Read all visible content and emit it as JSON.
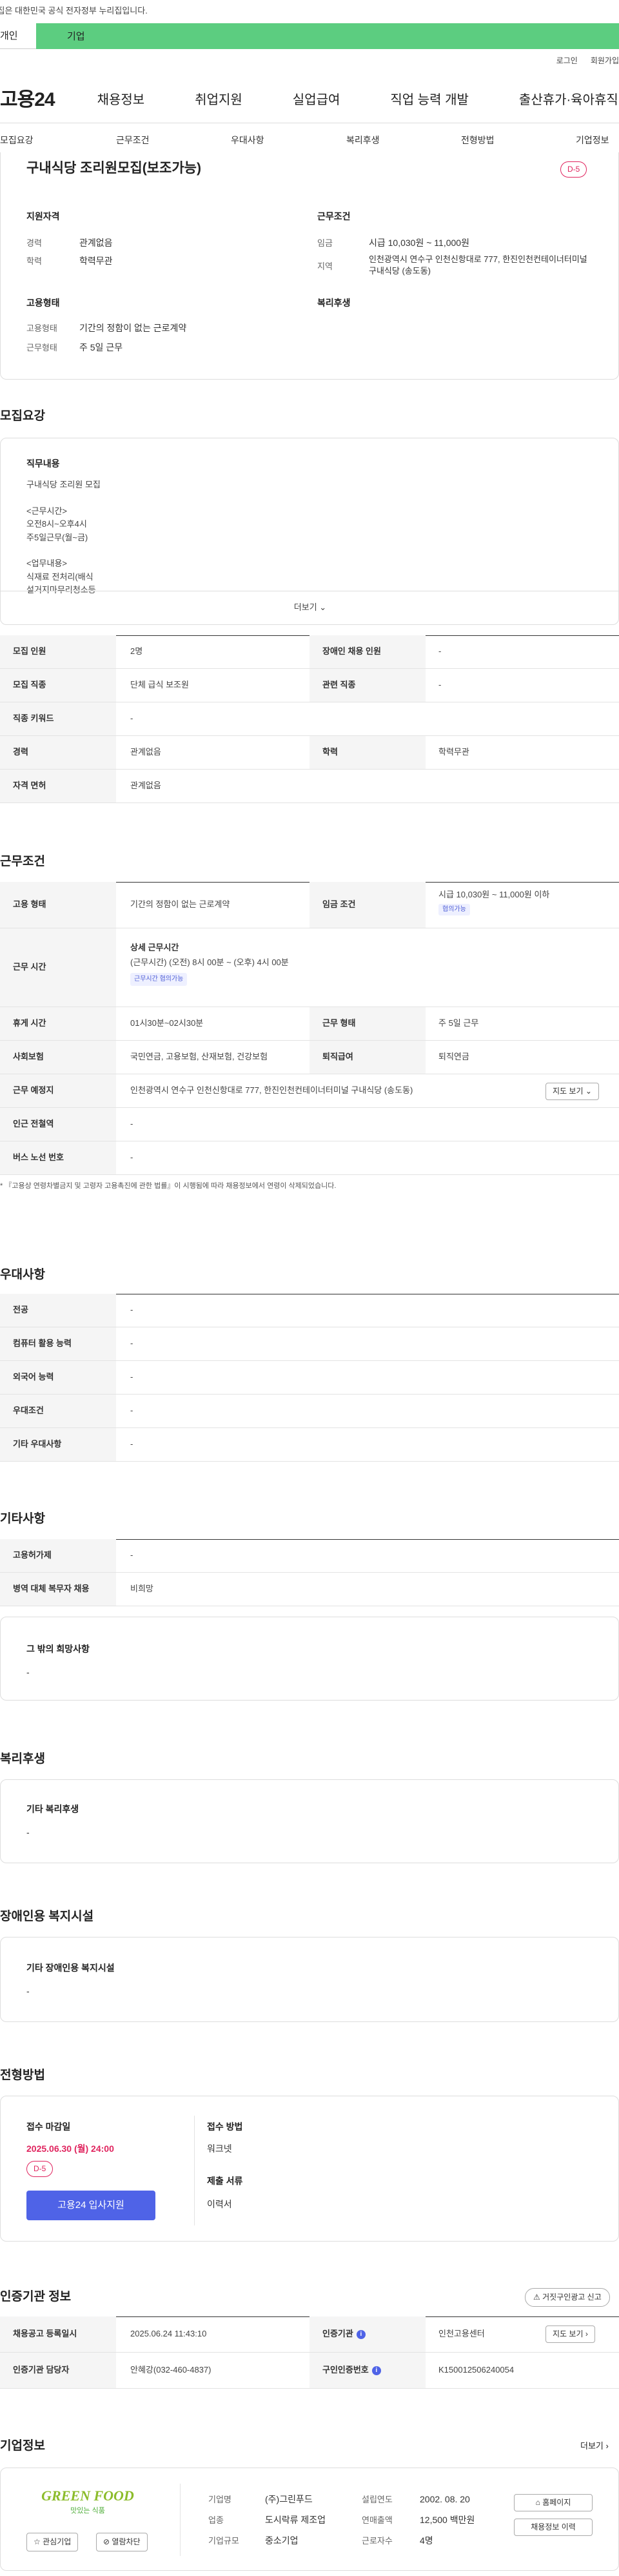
{
  "notice": "이 누리집은 대한민국 공식 전자정부 누리집입니다.",
  "user_tabs": [
    "개인",
    "기업"
  ],
  "util": [
    "로그인",
    "회원가입"
  ],
  "gnb": {
    "logo": "고용24",
    "menu": [
      "채용정보",
      "취업지원",
      "실업급여",
      "직업 능력 개발",
      "출산휴가·육아휴직"
    ]
  },
  "snb": [
    "모집요강",
    "근무조건",
    "우대사항",
    "복리후생",
    "전형방법",
    "기업정보"
  ],
  "summary": {
    "title": "구내식당 조리원모집(보조가능)",
    "dday": "D-5",
    "qual_title": "지원자격",
    "career_k": "경력",
    "career_v": "관계없음",
    "edu_k": "학력",
    "edu_v": "학력무관",
    "work_title": "근무조건",
    "wage_k": "임금",
    "wage_v": "시급 10,030원 ~ 11,000원",
    "region_k": "지역",
    "region_v": "인천광역시 연수구 인천신항대로 777, 한진인천컨테이너터미널 구내식당 (송도동)",
    "emp_title": "고용형태",
    "emp_k": "고용형태",
    "emp_v": "기간의 정함이 없는 근로계약",
    "days_k": "근무형태",
    "days_v": "주 5일 근무",
    "welfare_title": "복리후생"
  },
  "recruit": {
    "section": "모집요강",
    "content_title": "직무내용",
    "content_lines": [
      "구내식당 조리원 모집",
      "",
      "<근무시간>",
      "오전8시~오후4시",
      "주5일근무(월~금)",
      "",
      "<업무내용>",
      "식재료 전처리(배식",
      "설거지마무리청소등"
    ],
    "more": "더보기",
    "rows": [
      {
        "k1": "모집 인원",
        "v1": "2명",
        "k2": "장애인 채용 인원",
        "v2": "-"
      },
      {
        "k1": "모집 직종",
        "v1": "단체 급식 보조원",
        "k2": "관련 직종",
        "v2": "-"
      },
      {
        "k1": "직종 키워드",
        "v1": "-"
      },
      {
        "k1": "경력",
        "v1": "관계없음",
        "k2": "학력",
        "v2": "학력무관"
      },
      {
        "k1": "자격 면허",
        "v1": "관계없음"
      }
    ]
  },
  "conditions": {
    "section": "근무조건",
    "emp_k": "고용 형태",
    "emp_v": "기간의 정함이 없는 근로계약",
    "wage_k": "임금 조건",
    "wage_v": "시급 10,030원 ~ 11,000원 이하",
    "wage_tag": "협의가능",
    "time_k": "근무 시간",
    "time_title": "상세 근무시간",
    "time_v": "(근무시간) (오전) 8시 00분 ~ (오후) 4시 00분",
    "time_tag": "근무시간 협의가능",
    "rest_k": "휴게 시간",
    "rest_v": "01시30분~02시30분",
    "type_k": "근무 형태",
    "type_v": "주 5일 근무",
    "ins_k": "사회보험",
    "ins_v": "국민연금, 고용보험, 산재보험, 건강보험",
    "ret_k": "퇴직급여",
    "ret_v": "퇴직연금",
    "place_k": "근무 예정지",
    "place_v": "인천광역시 연수구 인천신항대로 777, 한진인천컨테이너터미널 구내식당 (송도동)",
    "map_btn": "지도 보기",
    "subway_k": "인근 전철역",
    "subway_v": "-",
    "bus_k": "버스 노선 번호",
    "bus_v": "-",
    "note": "* 『고용상 연령차별금지 및 고령자 고용촉진에 관한 법률』이 시행됨에 따라 채용정보에서 연령이 삭제되었습니다."
  },
  "pref": {
    "section": "우대사항",
    "rows": [
      [
        "전공",
        "-"
      ],
      [
        "컴퓨터 활용 능력",
        "-"
      ],
      [
        "외국어 능력",
        "-"
      ],
      [
        "우대조건",
        "-"
      ],
      [
        "기타 우대사항",
        "-"
      ]
    ]
  },
  "etc": {
    "section": "기타사항",
    "rows": [
      [
        "고용허가제",
        "-"
      ],
      [
        "병역 대체 복무자 채용",
        "비희망"
      ]
    ],
    "box_title": "그 밖의 희망사항",
    "box_v": "-"
  },
  "welfare": {
    "section": "복리후생",
    "box_title": "기타 복리후생",
    "box_v": "-"
  },
  "disabled": {
    "section": "장애인용 복지시설",
    "box_title": "기타 장애인용 복지시설",
    "box_v": "-"
  },
  "screening": {
    "section": "전형방법",
    "deadline_title": "접수 마감일",
    "deadline_v": "2025.06.30 (월) 24:00",
    "dday": "D-5",
    "apply_btn": "고용24 입사지원",
    "method_title": "접수 방법",
    "method_v": "워크넷",
    "docs_title": "제출 서류",
    "docs_v": "이력서"
  },
  "agency": {
    "section": "인증기관 정보",
    "report_btn": "거짓구인광고 신고",
    "r1k1": "채용공고 등록일시",
    "r1v1": "2025.06.24 11:43:10",
    "r1k2": "인증기관",
    "r1v2": "인천고용센터",
    "map_btn": "지도 보기",
    "r2k1": "인증기관 담당자",
    "r2v1": "안혜강(032-460-4837)",
    "r2k2": "구인인증번호",
    "r2v2": "K150012506240054"
  },
  "company": {
    "section": "기업정보",
    "more": "더보기",
    "logo1": "GREEN FOOD",
    "logo2": "맛있는 식품",
    "fav_btn": "관심기업",
    "block_btn": "열람차단",
    "name_k": "기업명",
    "name_v": "(주)그린푸드",
    "year_k": "설립연도",
    "year_v": "2002. 08. 20",
    "ind_k": "업종",
    "ind_v": "도시락류 제조업",
    "sales_k": "연매출액",
    "sales_v": "12,500 백만원",
    "size_k": "기업규모",
    "size_v": "중소기업",
    "emp_k": "근로자수",
    "emp_v": "4명",
    "home_btn": "홈페이지",
    "hist_btn": "채용정보 이력"
  },
  "colors": {
    "brand_green": "#5ccd80",
    "primary": "#4f63e7",
    "dday": "#e0245e"
  }
}
